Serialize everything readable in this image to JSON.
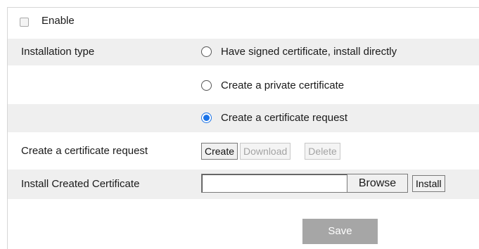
{
  "enable": {
    "label": "Enable",
    "checked": false
  },
  "installation_type": {
    "label": "Installation type",
    "options": [
      {
        "label": "Have signed certificate, install directly",
        "selected": false
      },
      {
        "label": "Create a private certificate",
        "selected": false
      },
      {
        "label": "Create a certificate request",
        "selected": true
      }
    ]
  },
  "certificate_request": {
    "label": "Create a certificate request",
    "create_label": "Create",
    "download_label": "Download",
    "delete_label": "Delete"
  },
  "install_created": {
    "label": "Install Created Certificate",
    "file_value": "",
    "browse_label": "Browse",
    "install_label": "Install"
  },
  "save_label": "Save",
  "colors": {
    "row_shade": "#efefef",
    "radio_accent": "#1a73e8",
    "save_button": "#a6a6a6"
  }
}
